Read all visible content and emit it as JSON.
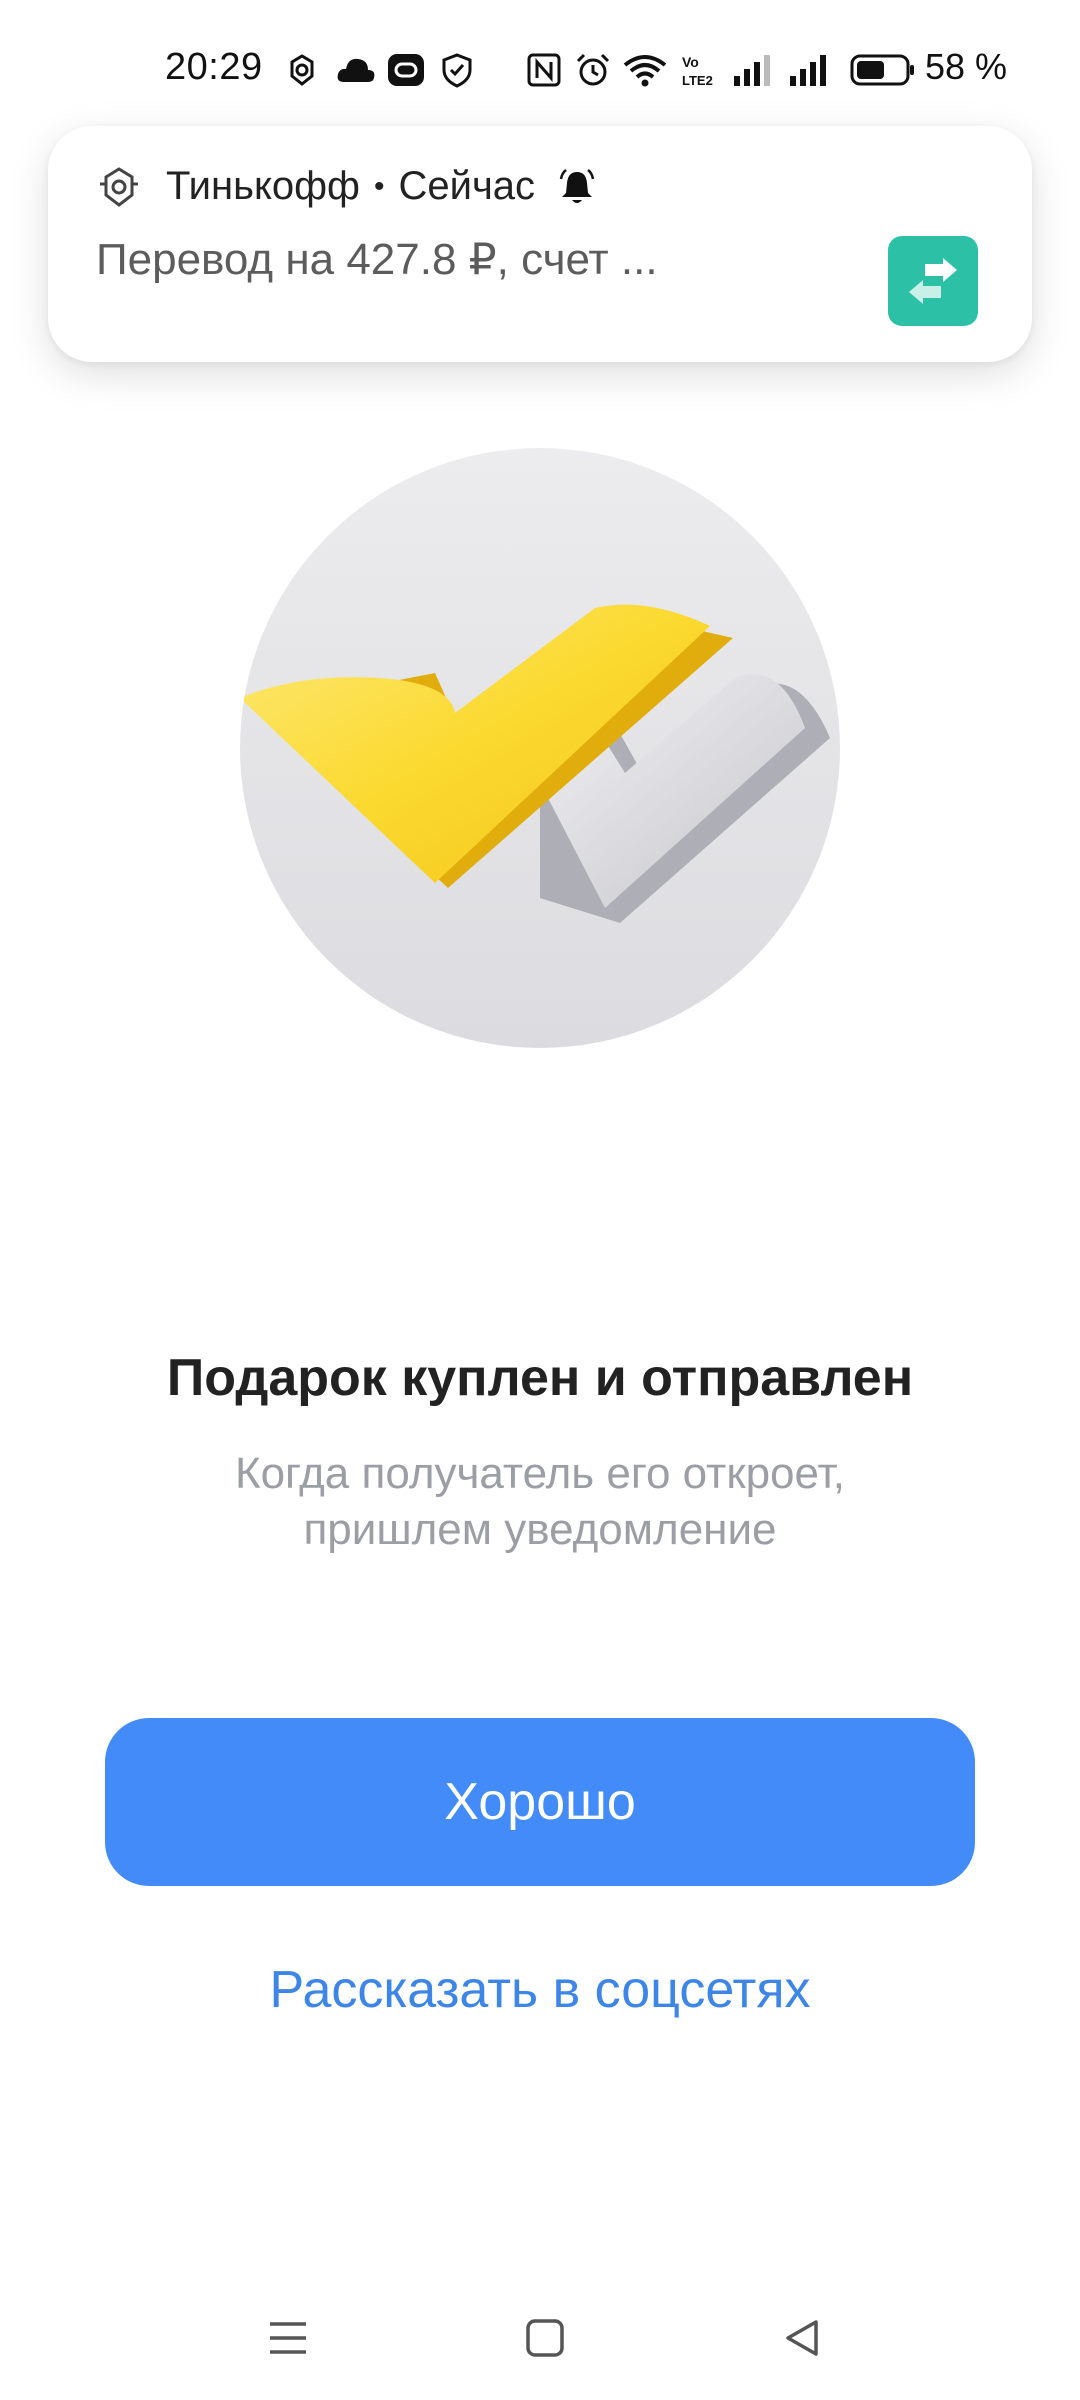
{
  "status_bar": {
    "time": "20:29",
    "battery_percent": "58 %",
    "icons": [
      "tinkoff-icon",
      "cloud-icon",
      "link-icon",
      "shield-icon",
      "nfc-icon",
      "alarm-icon",
      "wifi-icon",
      "volte-icon",
      "signal-1-icon",
      "signal-2-icon",
      "battery-icon"
    ],
    "battery_level": 0.58
  },
  "notification": {
    "app_name": "Тинькофф",
    "separator": "•",
    "time": "Сейчас",
    "body": "Перевод на 427.8 ₽, счет ...",
    "icon": "bell-icon",
    "action_icon": "transfer-icon",
    "action_color": "#2cc0a6"
  },
  "main": {
    "title": "Подарок куплен и отправлен",
    "subtitle": "Когда получатель его откроет, пришлем уведомление",
    "primary_button": "Хорошо",
    "secondary_link": "Рассказать в соцсетях"
  },
  "colors": {
    "accent": "#428bf9",
    "link": "#3d86e8",
    "checkmark_yellow": "#fbd22f",
    "checkmark_gray": "#c8c8cc"
  },
  "navbar": {
    "buttons": [
      "menu-icon",
      "home-icon",
      "back-icon"
    ]
  }
}
